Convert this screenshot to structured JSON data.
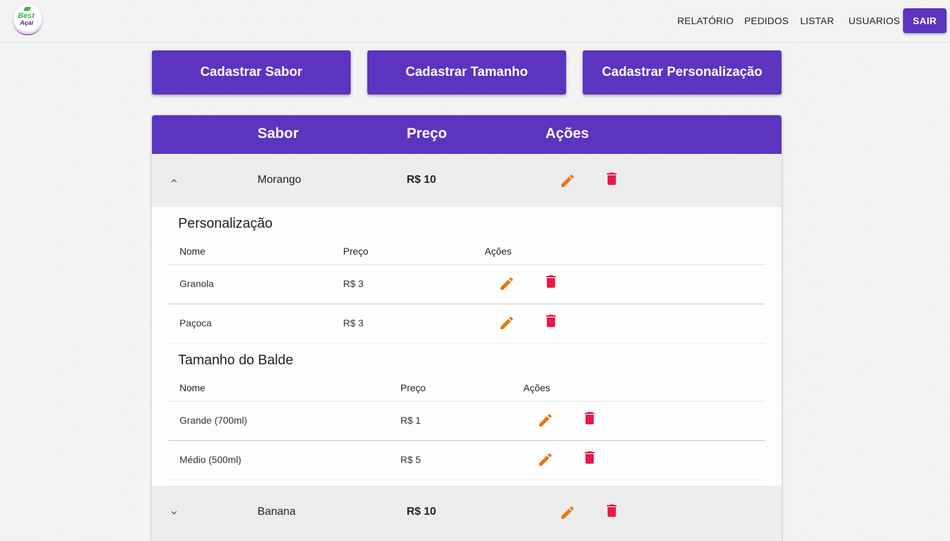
{
  "nav": {
    "items": [
      "RELATÓRIO",
      "PEDIDOS",
      "LISTAR",
      "USUARIOS"
    ],
    "logout": "SAIR"
  },
  "logo": {
    "line1": "Best",
    "line2": "Açaí"
  },
  "actions": [
    "Cadastrar Sabor",
    "Cadastrar Tamanho",
    "Cadastrar Personalização"
  ],
  "table": {
    "headers": [
      "Sabor",
      "Preço",
      "Ações"
    ],
    "rows": [
      {
        "name": "Morango",
        "price": "R$ 10",
        "expanded": true
      },
      {
        "name": "Banana",
        "price": "R$ 10",
        "expanded": false
      }
    ]
  },
  "personalizacao": {
    "title": "Personalização",
    "headers": [
      "Nome",
      "Preço",
      "Ações"
    ],
    "rows": [
      {
        "name": "Granola",
        "price": "R$ 3"
      },
      {
        "name": "Paçoca",
        "price": "R$ 3"
      }
    ]
  },
  "tamanho": {
    "title": "Tamanho do Balde",
    "headers": [
      "Nome",
      "Preço",
      "Ações"
    ],
    "rows": [
      {
        "name": "Grande (700ml)",
        "price": "R$ 1"
      },
      {
        "name": "Médio (500ml)",
        "price": "R$ 5"
      }
    ]
  },
  "colors": {
    "primary": "#5b34c0",
    "edit": "#e8780f",
    "delete": "#e8194a"
  },
  "icons": [
    "edit-icon",
    "delete-icon",
    "chevron-up-icon",
    "chevron-down-icon"
  ]
}
